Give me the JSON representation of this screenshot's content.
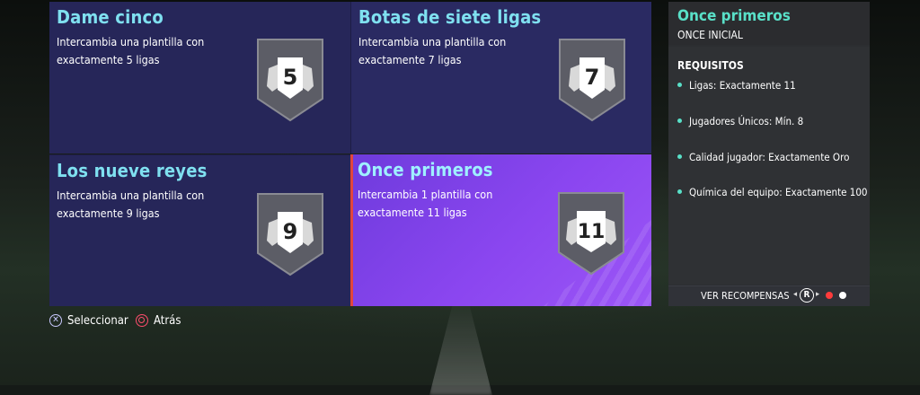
{
  "tiles": [
    {
      "title": "Dame cinco",
      "desc_line1": "Intercambia una plantilla con",
      "desc_line2": "exactamente 5 ligas",
      "badge_number": "5"
    },
    {
      "title": "Botas de siete ligas",
      "desc_line1": "Intercambia una plantilla con",
      "desc_line2": "exactamente 7 ligas",
      "badge_number": "7"
    },
    {
      "title": "Los nueve reyes",
      "desc_line1": "Intercambia una plantilla con",
      "desc_line2": "exactamente 9 ligas",
      "badge_number": "9"
    },
    {
      "title": "Once primeros",
      "desc_line1": "Intercambia 1 plantilla con",
      "desc_line2": "exactamente 11 ligas",
      "badge_number": "11",
      "selected": true
    }
  ],
  "panel": {
    "title": "Once primeros",
    "subtitle": "ONCE INICIAL",
    "requirements_title": "REQUISITOS",
    "requirements": [
      "Ligas: Exactamente 11",
      "Jugadores Únicos: Mín. 8",
      "Calidad jugador: Exactamente Oro",
      "Química del equipo: Exactamente 100"
    ],
    "footer_label": "VER RECOMPENSAS",
    "footer_button": "R",
    "page_dots": {
      "active_color": "#ff3b3b",
      "inactive_color": "#ffffff"
    }
  },
  "controls": {
    "select_label": "Seleccionar",
    "back_label": "Atrás"
  },
  "icons": [
    "shield-badge-icon",
    "cross-button-icon",
    "circle-button-icon",
    "r-stick-icon"
  ],
  "colors": {
    "tile_bg": "#262659",
    "selected_tile": "#8b46f0",
    "title_cyan": "#7fe0f0",
    "panel_accent": "#59e0c8"
  }
}
